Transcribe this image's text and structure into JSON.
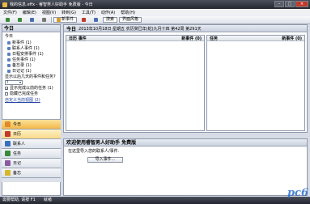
{
  "window": {
    "title": "我的信息.effx - 睿智男人好助手 免费版 - 今日",
    "min": "–",
    "max": "□",
    "close": "×"
  },
  "menu": [
    "文件(F)",
    "编辑(E)",
    "视图(V)",
    "转到(G)",
    "工具(T)",
    "动作(A)",
    "帮助(H)"
  ],
  "toolbar": {
    "new_label": "新事件",
    "search_label": "搜索",
    "interface_label": "界面风格"
  },
  "sidebar": {
    "title": "今日",
    "subtitle": "今日",
    "tree": [
      {
        "label": "新事件 (1)"
      },
      {
        "label": "联系人事件 (1)"
      },
      {
        "label": "日程安排事件 (1)"
      },
      {
        "label": "任务事件 (1)"
      },
      {
        "label": "备忘录 (1)"
      },
      {
        "label": "日记记 (1)"
      }
    ],
    "days_label": "显示以后几天的事件和任务?",
    "days_value": "7",
    "opt1": "显示完成以前的任务 (1)",
    "opt2": "隐藏已完成任务",
    "link": "自定义当前视图 (2)"
  },
  "nav": [
    {
      "label": "今日",
      "active": true
    },
    {
      "label": "日历",
      "hover": true
    },
    {
      "label": "联系人"
    },
    {
      "label": "任务"
    },
    {
      "label": "日记"
    },
    {
      "label": "备忘"
    }
  ],
  "main": {
    "title": "今日",
    "date": "2013年10月18日 星期五 农历癸巳年(蛇)九月十四 第42周 第291天",
    "left_panel": {
      "col1": "日历 事件",
      "col2": "新事件 (0)"
    },
    "right_panel": {
      "col1": "任务",
      "col2": "新事件 (0)"
    }
  },
  "bottom": {
    "title": "欢迎使用睿智男人好助手 免费版",
    "text": "在这里导入您的联系人/事件.",
    "button": "导入事件..."
  },
  "status": {
    "text": "需要帮助, 请按 F1",
    "extra": "就绪"
  },
  "logo": "pc6"
}
